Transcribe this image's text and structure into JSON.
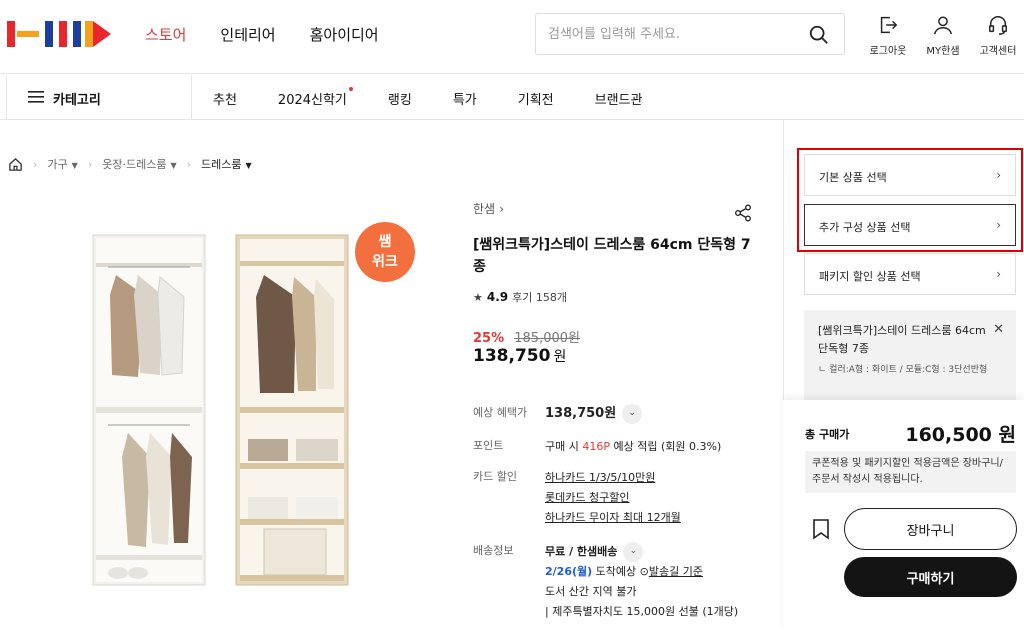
{
  "header": {
    "nav": [
      "스토어",
      "인테리어",
      "홈아이디어"
    ],
    "active_nav": 0,
    "search_placeholder": "검색어를 입력해 주세요.",
    "utils": [
      "로그아웃",
      "MY한샘",
      "고객센터"
    ]
  },
  "catbar": {
    "category_label": "카테고리",
    "items": [
      "추천",
      "2024신학기",
      "랭킹",
      "특가",
      "기획전",
      "브랜드관"
    ]
  },
  "breadcrumb": [
    "가구",
    "옷장·드레스룸",
    "드레스룸"
  ],
  "product": {
    "badge": [
      "쌤",
      "위크"
    ],
    "brand": "한샘",
    "title": "[쌤위크특가]스테이 드레스룸 64cm 단독형 7종",
    "rating": "4.9",
    "review": "후기 158개",
    "discount": "25%",
    "original_price": "185,000원",
    "price": "138,750",
    "price_unit": "원"
  },
  "specs": {
    "benefit": {
      "label": "예상 혜택가",
      "value": "138,750원"
    },
    "point": {
      "label": "포인트",
      "prefix": "구매 시 ",
      "amount": "416P",
      "suffix": " 예상 적립 (회원 0.3%)"
    },
    "card": {
      "label": "카드 할인",
      "links": [
        "하나카드 1/3/5/10만원",
        "롯데카드 청구할인",
        "하나카드 무이자 최대 12개월"
      ]
    },
    "delivery": {
      "label": "배송정보",
      "type": "무료 / 한샘배송",
      "date": "2/26(월)",
      "date_suffix": " 도착예상",
      "basis": "발송길 기준",
      "line2": "도서 산간 지역 불가",
      "line3": "| 제주특별자치도 15,000원 선불 (1개당)"
    }
  },
  "options": {
    "basic": "기본 상품 선택",
    "extra": "추가 구성 상품 선택",
    "package": "패키지 할인 상품 선택"
  },
  "selected_item": {
    "name": "[쌤위크특가]스테이 드레스룸 64cm 단독형 7종",
    "option": "ㄴ 컬러:A형 : 화이트 / 모듈:C형 : 3단선반형"
  },
  "summary": {
    "total_label": "총 구매가",
    "total_value": "160,500 원",
    "note": "쿠폰적용 및 패키지할인 적용금액은 장바구니/주문서 작성시 적용됩니다.",
    "cart_label": "장바구니",
    "buy_label": "구매하기"
  },
  "colors": {
    "accent": "#e53935",
    "badge": "#f36f3e",
    "highlight": "#e00000"
  }
}
